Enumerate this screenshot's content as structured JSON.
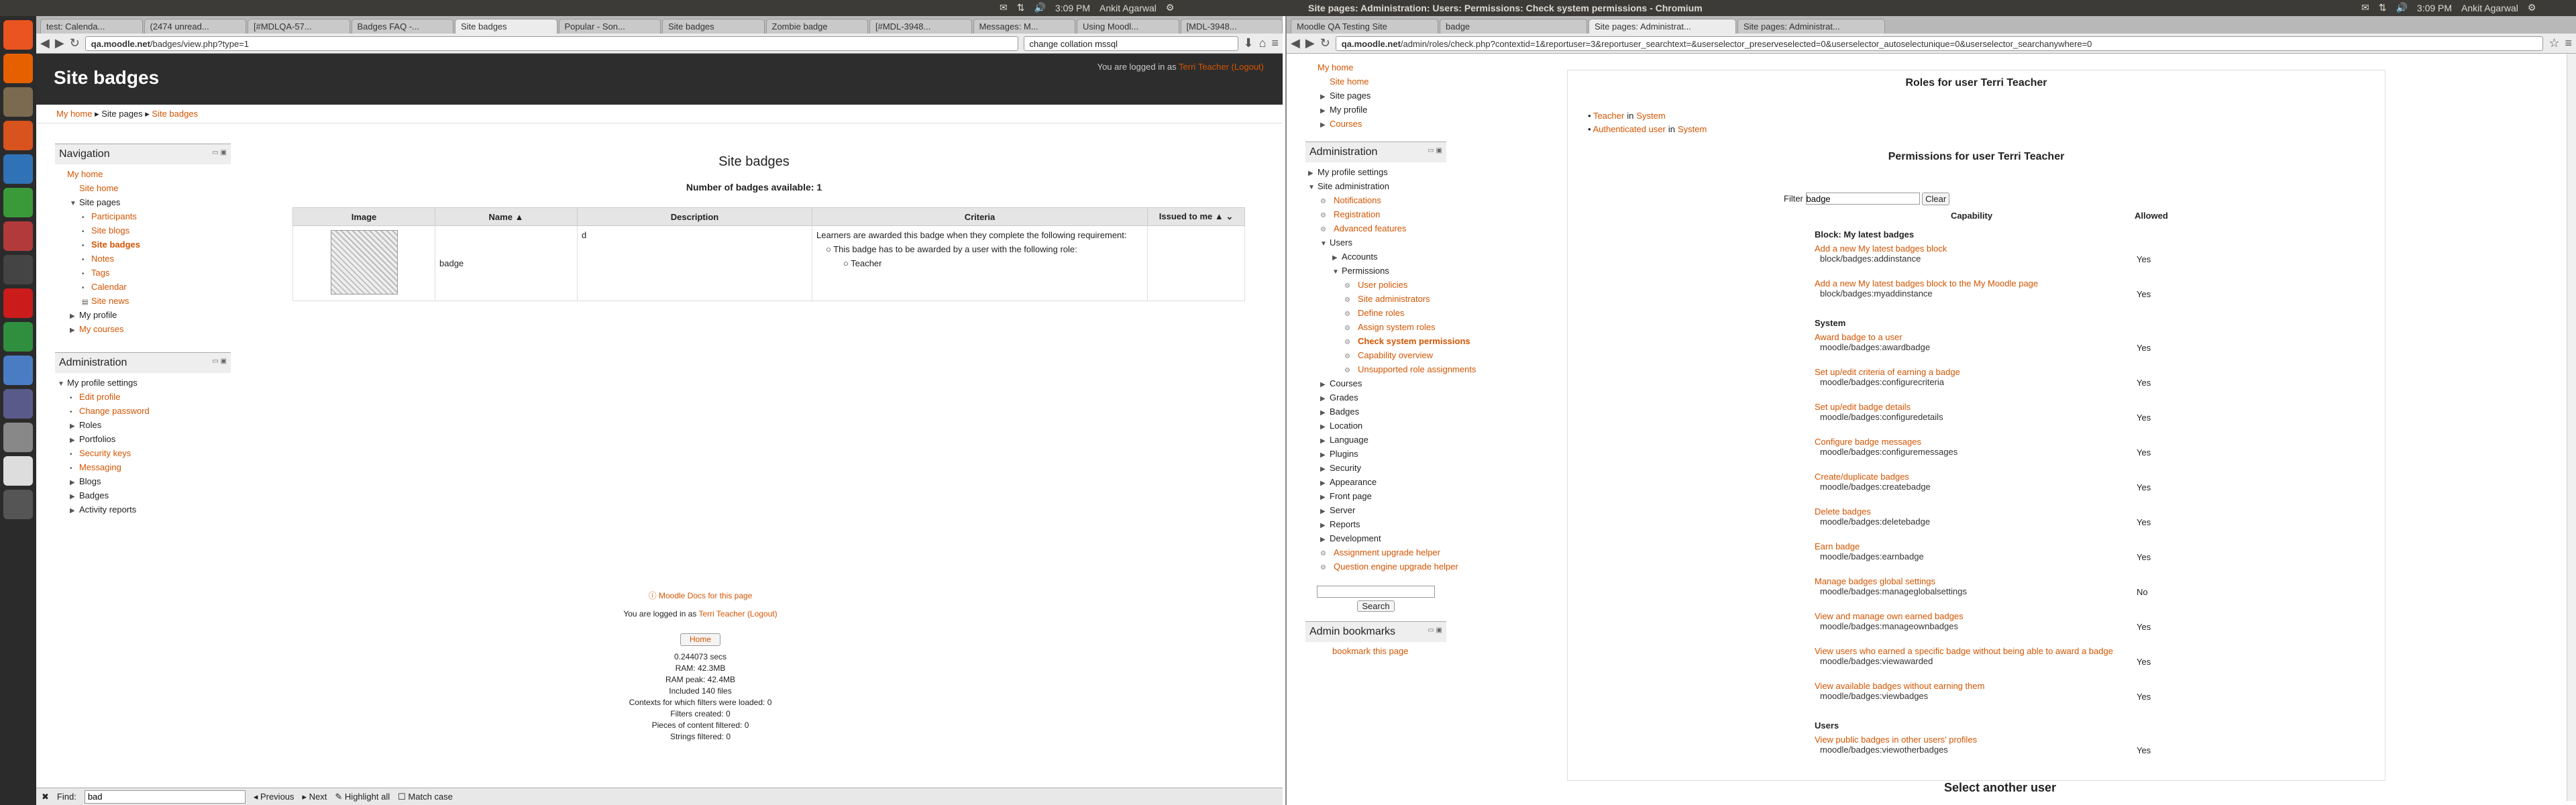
{
  "topbar": {
    "left_title": "",
    "right_title": "Site pages: Administration: Users: Permissions: Check system permissions - Chromium",
    "left_clock": "3:09 PM",
    "left_user": "Ankit Agarwal",
    "right_clock": "3:09 PM",
    "right_user": "Ankit Agarwal"
  },
  "left": {
    "tabs": [
      "test: Calenda...",
      "(2474 unread...",
      "[#MDLQA-57...",
      "Badges FAQ -...",
      "Site badges",
      "Popular - Son...",
      "Site badges",
      "Zombie badge",
      "[#MDL-3948...",
      "Messages: M...",
      "Using Moodl...",
      "[MDL-3948..."
    ],
    "active_tab": 4,
    "url_host": "qa.moodle.net",
    "url_path": "/badges/view.php?type=1",
    "search_box": "change collation mssql",
    "page_title": "Site badges",
    "login_text": "You are logged in as",
    "login_user": "Terri Teacher",
    "logout": "(Logout)",
    "breadcrumb": [
      "My home",
      "Site pages",
      "Site badges"
    ],
    "nav_block_title": "Navigation",
    "nav_items": [
      {
        "label": "My home",
        "level": 0,
        "link": true,
        "arrow": ""
      },
      {
        "label": "Site home",
        "level": 1,
        "link": true,
        "arrow": ""
      },
      {
        "label": "Site pages",
        "level": 1,
        "link": false,
        "arrow": "▼"
      },
      {
        "label": "Participants",
        "level": 2,
        "link": true,
        "arrow": "•"
      },
      {
        "label": "Site blogs",
        "level": 2,
        "link": true,
        "arrow": "•"
      },
      {
        "label": "Site badges",
        "level": 2,
        "link": true,
        "arrow": "•",
        "bold": true
      },
      {
        "label": "Notes",
        "level": 2,
        "link": true,
        "arrow": "•"
      },
      {
        "label": "Tags",
        "level": 2,
        "link": true,
        "arrow": "•"
      },
      {
        "label": "Calendar",
        "level": 2,
        "link": true,
        "arrow": "•"
      },
      {
        "label": "Site news",
        "level": 2,
        "link": true,
        "arrow": "▤"
      },
      {
        "label": "My profile",
        "level": 1,
        "link": false,
        "arrow": "▶"
      },
      {
        "label": "My courses",
        "level": 1,
        "link": true,
        "arrow": "▶"
      }
    ],
    "admin_block_title": "Administration",
    "admin_items": [
      {
        "label": "My profile settings",
        "level": 0,
        "link": false,
        "arrow": "▼"
      },
      {
        "label": "Edit profile",
        "level": 1,
        "link": true,
        "arrow": "•"
      },
      {
        "label": "Change password",
        "level": 1,
        "link": true,
        "arrow": "•"
      },
      {
        "label": "Roles",
        "level": 1,
        "link": false,
        "arrow": "▶"
      },
      {
        "label": "Portfolios",
        "level": 1,
        "link": false,
        "arrow": "▶"
      },
      {
        "label": "Security keys",
        "level": 1,
        "link": true,
        "arrow": "•"
      },
      {
        "label": "Messaging",
        "level": 1,
        "link": true,
        "arrow": "•"
      },
      {
        "label": "Blogs",
        "level": 1,
        "link": false,
        "arrow": "▶"
      },
      {
        "label": "Badges",
        "level": 1,
        "link": false,
        "arrow": "▶"
      },
      {
        "label": "Activity reports",
        "level": 1,
        "link": false,
        "arrow": "▶"
      }
    ],
    "main_heading": "Site badges",
    "count_text": "Number of badges available: 1",
    "table_headers": [
      "Image",
      "Name ▲",
      "Description",
      "Criteria",
      "Issued to me ▲ ⌄"
    ],
    "badge_name": "badge",
    "badge_desc": "d",
    "criteria_intro": "Learners are awarded this badge when they complete the following requirement:",
    "criteria_item": "This badge has to be awarded by a user with the following role:",
    "criteria_role": "Teacher",
    "docs_link": "Moodle Docs for this page",
    "footer_login": "You are logged in as",
    "footer_user": "Terri Teacher",
    "footer_logout": "(Logout)",
    "home_button": "Home",
    "perf": [
      "0.244073 secs",
      "RAM: 42.3MB",
      "RAM peak: 42.4MB",
      "Included 140 files",
      "Contexts for which filters were loaded: 0",
      "Filters created: 0",
      "Pieces of content filtered: 0",
      "Strings filtered: 0"
    ],
    "find_label": "Find:",
    "find_value": "bad",
    "find_prev": "Previous",
    "find_next": "Next",
    "find_highlight": "Highlight all",
    "find_match": "Match case"
  },
  "right": {
    "tabs": [
      "Moodle QA Testing Site",
      "badge",
      "Site pages: Administrat...",
      "Site pages: Administrat..."
    ],
    "active_tab": 2,
    "url_host": "qa.moodle.net",
    "url_path": "/admin/roles/check.php?contextid=1&reportuser=3&reportuser_searchtext=&userselector_preserveselected=0&userselector_autoselectunique=0&userselector_searchanywhere=0",
    "nav_items": [
      {
        "label": "My home",
        "level": 0,
        "link": true,
        "arrow": ""
      },
      {
        "label": "Site home",
        "level": 1,
        "link": true,
        "arrow": ""
      },
      {
        "label": "Site pages",
        "level": 1,
        "link": false,
        "arrow": "▶"
      },
      {
        "label": "My profile",
        "level": 1,
        "link": false,
        "arrow": "▶"
      },
      {
        "label": "Courses",
        "level": 1,
        "link": true,
        "arrow": "▶"
      }
    ],
    "admin_block_title": "Administration",
    "admin_items": [
      {
        "label": "My profile settings",
        "level": 0,
        "link": false,
        "arrow": "▶"
      },
      {
        "label": "Site administration",
        "level": 0,
        "link": false,
        "arrow": "▼"
      },
      {
        "label": "Notifications",
        "level": 1,
        "link": true,
        "arrow": "⚙"
      },
      {
        "label": "Registration",
        "level": 1,
        "link": true,
        "arrow": "⚙"
      },
      {
        "label": "Advanced features",
        "level": 1,
        "link": true,
        "arrow": "⚙"
      },
      {
        "label": "Users",
        "level": 1,
        "link": false,
        "arrow": "▼"
      },
      {
        "label": "Accounts",
        "level": 2,
        "link": false,
        "arrow": "▶"
      },
      {
        "label": "Permissions",
        "level": 2,
        "link": false,
        "arrow": "▼"
      },
      {
        "label": "User policies",
        "level": 3,
        "link": true,
        "arrow": "⚙"
      },
      {
        "label": "Site administrators",
        "level": 3,
        "link": true,
        "arrow": "⚙"
      },
      {
        "label": "Define roles",
        "level": 3,
        "link": true,
        "arrow": "⚙"
      },
      {
        "label": "Assign system roles",
        "level": 3,
        "link": true,
        "arrow": "⚙"
      },
      {
        "label": "Check system permissions",
        "level": 3,
        "link": true,
        "arrow": "⚙",
        "bold": true
      },
      {
        "label": "Capability overview",
        "level": 3,
        "link": true,
        "arrow": "⚙"
      },
      {
        "label": "Unsupported role assignments",
        "level": 3,
        "link": true,
        "arrow": "⚙"
      },
      {
        "label": "Courses",
        "level": 1,
        "link": false,
        "arrow": "▶"
      },
      {
        "label": "Grades",
        "level": 1,
        "link": false,
        "arrow": "▶"
      },
      {
        "label": "Badges",
        "level": 1,
        "link": false,
        "arrow": "▶"
      },
      {
        "label": "Location",
        "level": 1,
        "link": false,
        "arrow": "▶"
      },
      {
        "label": "Language",
        "level": 1,
        "link": false,
        "arrow": "▶"
      },
      {
        "label": "Plugins",
        "level": 1,
        "link": false,
        "arrow": "▶"
      },
      {
        "label": "Security",
        "level": 1,
        "link": false,
        "arrow": "▶"
      },
      {
        "label": "Appearance",
        "level": 1,
        "link": false,
        "arrow": "▶"
      },
      {
        "label": "Front page",
        "level": 1,
        "link": false,
        "arrow": "▶"
      },
      {
        "label": "Server",
        "level": 1,
        "link": false,
        "arrow": "▶"
      },
      {
        "label": "Reports",
        "level": 1,
        "link": false,
        "arrow": "▶"
      },
      {
        "label": "Development",
        "level": 1,
        "link": false,
        "arrow": "▶"
      },
      {
        "label": "Assignment upgrade helper",
        "level": 1,
        "link": true,
        "arrow": "⚙"
      },
      {
        "label": "Question engine upgrade helper",
        "level": 1,
        "link": true,
        "arrow": "⚙"
      }
    ],
    "search_button": "Search",
    "bookmarks_title": "Admin bookmarks",
    "bookmark_link": "bookmark this page",
    "roles_heading": "Roles for user Terri Teacher",
    "roles": [
      {
        "role": "Teacher",
        "in": "in",
        "ctx": "System"
      },
      {
        "role": "Authenticated user",
        "in": "in",
        "ctx": "System"
      }
    ],
    "perm_heading": "Permissions for user Terri Teacher",
    "filter_label": "Filter",
    "filter_value": "badge",
    "clear_button": "Clear",
    "col_capability": "Capability",
    "col_allowed": "Allowed",
    "perm_rows": [
      {
        "section": "Block: My latest badges"
      },
      {
        "name": "Add a new My latest badges block",
        "cap": "block/badges:addinstance",
        "allowed": "Yes"
      },
      {
        "name": "Add a new My latest badges block to the My Moodle page",
        "cap": "block/badges:myaddinstance",
        "allowed": "Yes"
      },
      {
        "section": "System"
      },
      {
        "name": "Award badge to a user",
        "cap": "moodle/badges:awardbadge",
        "allowed": "Yes"
      },
      {
        "name": "Set up/edit criteria of earning a badge",
        "cap": "moodle/badges:configurecriteria",
        "allowed": "Yes"
      },
      {
        "name": "Set up/edit badge details",
        "cap": "moodle/badges:configuredetails",
        "allowed": "Yes"
      },
      {
        "name": "Configure badge messages",
        "cap": "moodle/badges:configuremessages",
        "allowed": "Yes"
      },
      {
        "name": "Create/duplicate badges",
        "cap": "moodle/badges:createbadge",
        "allowed": "Yes"
      },
      {
        "name": "Delete badges",
        "cap": "moodle/badges:deletebadge",
        "allowed": "Yes"
      },
      {
        "name": "Earn badge",
        "cap": "moodle/badges:earnbadge",
        "allowed": "Yes"
      },
      {
        "name": "Manage badges global settings",
        "cap": "moodle/badges:manageglobalsettings",
        "allowed": "No"
      },
      {
        "name": "View and manage own earned badges",
        "cap": "moodle/badges:manageownbadges",
        "allowed": "Yes"
      },
      {
        "name": "View users who earned a specific badge without being able to award a badge",
        "cap": "moodle/badges:viewawarded",
        "allowed": "Yes"
      },
      {
        "name": "View available badges without earning them",
        "cap": "moodle/badges:viewbadges",
        "allowed": "Yes"
      },
      {
        "section": "Users"
      },
      {
        "name": "View public badges in other users' profiles",
        "cap": "moodle/badges:viewotherbadges",
        "allowed": "Yes"
      }
    ],
    "select_another": "Select another user"
  },
  "icons": {
    "launcher": [
      "ubuntu-dash-icon",
      "firefox-icon",
      "files-icon",
      "software-center-icon",
      "writer-icon",
      "calc-icon",
      "impress-icon",
      "terminal-icon",
      "opera-icon",
      "chrome-icon",
      "chromium-icon",
      "network-icon",
      "settings-icon",
      "text-editor-icon",
      "workspace-icon"
    ],
    "accent": "#d35400"
  }
}
